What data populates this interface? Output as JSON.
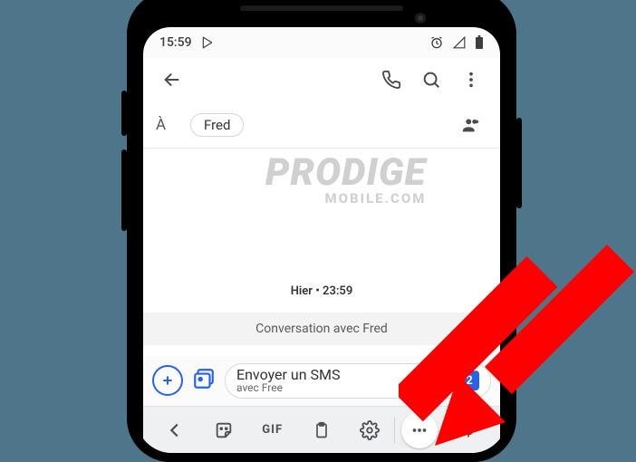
{
  "statusbar": {
    "time": "15:59"
  },
  "recipients": {
    "label": "À",
    "contact": "Fred"
  },
  "conversation": {
    "timestamp": "Hier • 23:59",
    "start_banner": "Conversation avec Fred"
  },
  "compose": {
    "placeholder_line1": "Envoyer un SMS",
    "placeholder_line2": "avec Free",
    "sim_badge": "2"
  },
  "keyboard": {
    "gif": "GIF"
  },
  "watermark": {
    "line1": "PRODIGE",
    "line2": "MOBILE.COM"
  }
}
